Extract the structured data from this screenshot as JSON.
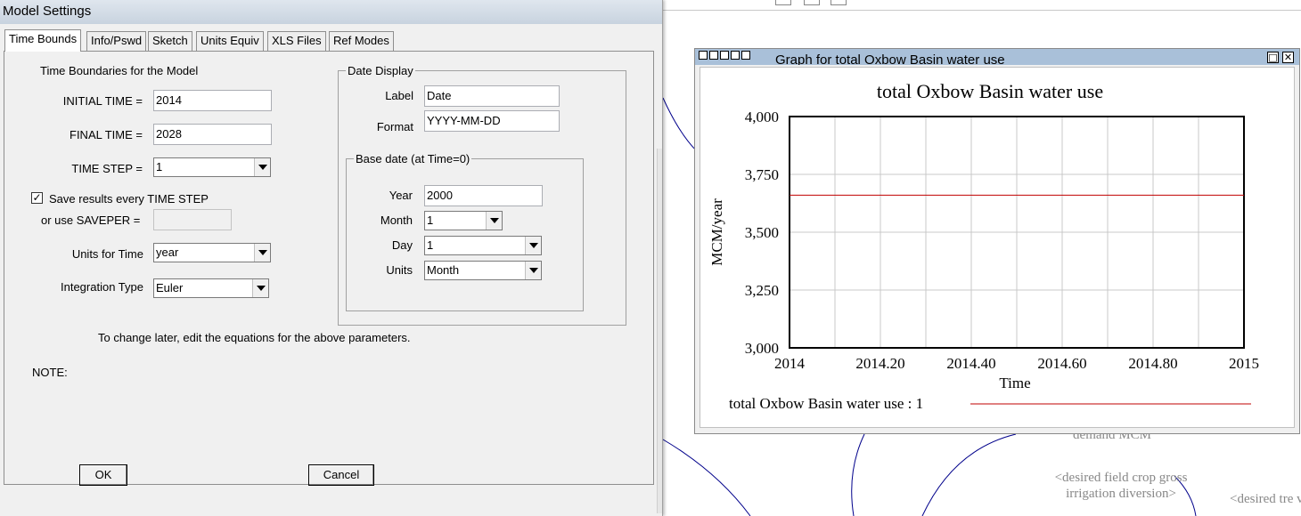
{
  "background": {
    "variables": [
      {
        "id": "v1",
        "text": "demand MCM"
      },
      {
        "id": "v2",
        "text": "<desired field crop gross irrigation diversion>"
      },
      {
        "id": "v3",
        "text": "<desired tre vine gross"
      }
    ],
    "line_color": "#00008b"
  },
  "dialog": {
    "title": "Model Settings",
    "tabs": [
      {
        "label": "Time Bounds",
        "active": true
      },
      {
        "label": "Info/Pswd"
      },
      {
        "label": "Sketch"
      },
      {
        "label": "Units Equiv"
      },
      {
        "label": "XLS Files"
      },
      {
        "label": "Ref Modes"
      }
    ],
    "time_boundaries_heading": "Time Boundaries for the Model",
    "initial_time": {
      "label": "INITIAL TIME =",
      "value": "2014"
    },
    "final_time": {
      "label": "FINAL TIME =",
      "value": "2028"
    },
    "time_step": {
      "label": "TIME STEP =",
      "value": "1"
    },
    "save_results": {
      "label": "Save results every TIME STEP",
      "checked": true,
      "mark": "✓"
    },
    "saveper": {
      "label": "or use SAVEPER =",
      "value": ""
    },
    "units_for_time": {
      "label": "Units for Time",
      "value": "year"
    },
    "integration_type": {
      "label": "Integration Type",
      "value": "Euler"
    },
    "date_display": {
      "title": "Date Display",
      "label_field": {
        "label": "Label",
        "value": "Date"
      },
      "format_field": {
        "label": "Format",
        "value": "YYYY-MM-DD"
      },
      "base_date": {
        "title": "Base date (at Time=0)",
        "year": {
          "label": "Year",
          "value": "2000"
        },
        "month": {
          "label": "Month",
          "value": "1"
        },
        "day": {
          "label": "Day",
          "value": "1"
        },
        "units": {
          "label": "Units",
          "value": "Month"
        }
      }
    },
    "change_note": "To change later, edit the equations for the above parameters.",
    "note_label": "NOTE:",
    "ok_label": "OK",
    "cancel_label": "Cancel"
  },
  "graph_window": {
    "title": "Graph for total Oxbow Basin water use",
    "restore_glyph": "□",
    "close_glyph": "✕",
    "chart_data": {
      "type": "line",
      "title": "total Oxbow Basin water use",
      "xlabel": "Time",
      "ylabel": "MCM/year",
      "xlim": [
        2014,
        2015
      ],
      "ylim": [
        3000,
        4000
      ],
      "x_ticks": [
        {
          "value": 2014,
          "label": "2014"
        },
        {
          "value": 2014.2,
          "label": "2014.20"
        },
        {
          "value": 2014.4,
          "label": "2014.40"
        },
        {
          "value": 2014.6,
          "label": "2014.60"
        },
        {
          "value": 2014.8,
          "label": "2014.80"
        },
        {
          "value": 2015,
          "label": "2015"
        }
      ],
      "y_ticks": [
        {
          "value": 3000,
          "label": "3,000"
        },
        {
          "value": 3250,
          "label": "3,250"
        },
        {
          "value": 3500,
          "label": "3,500"
        },
        {
          "value": 3750,
          "label": "3,750"
        },
        {
          "value": 4000,
          "label": "4,000"
        }
      ],
      "x_grid_step": 0.1,
      "grid": true,
      "legend_placement": "bottom",
      "series": [
        {
          "name": "total Oxbow Basin water use : 1",
          "color": "#c00000",
          "points": [
            {
              "x": 2014,
              "y": 3660
            },
            {
              "x": 2015,
              "y": 3660
            }
          ]
        }
      ]
    }
  }
}
